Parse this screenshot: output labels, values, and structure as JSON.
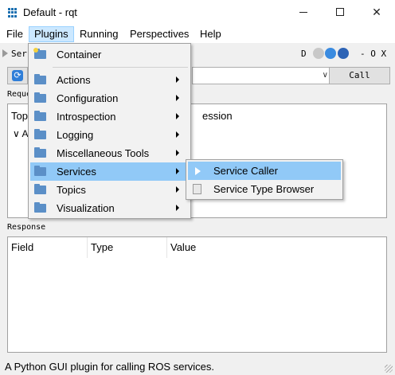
{
  "window": {
    "title": "Default - rqt"
  },
  "menubar": [
    "File",
    "Plugins",
    "Running",
    "Perspectives",
    "Help"
  ],
  "plugin_bar": {
    "title": "Ser",
    "right_label": "D",
    "controls": "- O X"
  },
  "service_row": {
    "combo_value": "",
    "call_label": "Call"
  },
  "request": {
    "label": "Reque",
    "col_left": "Top",
    "col_right": "ession",
    "chevron": "∨ A"
  },
  "response": {
    "label": "Response",
    "columns": [
      "Field",
      "Type",
      "Value"
    ]
  },
  "status": "A Python GUI plugin for calling ROS services.",
  "plugins_menu": {
    "items": [
      {
        "label": "Container",
        "icon": "container-icon",
        "has_submenu": false
      },
      {
        "label": "Actions",
        "icon": "folder-icon",
        "has_submenu": true
      },
      {
        "label": "Configuration",
        "icon": "folder-icon",
        "has_submenu": true
      },
      {
        "label": "Introspection",
        "icon": "folder-icon",
        "has_submenu": true
      },
      {
        "label": "Logging",
        "icon": "folder-icon",
        "has_submenu": true
      },
      {
        "label": "Miscellaneous Tools",
        "icon": "folder-icon",
        "has_submenu": true
      },
      {
        "label": "Services",
        "icon": "folder-icon",
        "has_submenu": true,
        "highlighted": true
      },
      {
        "label": "Topics",
        "icon": "folder-icon",
        "has_submenu": true
      },
      {
        "label": "Visualization",
        "icon": "folder-icon",
        "has_submenu": true
      }
    ]
  },
  "services_submenu": {
    "items": [
      {
        "label": "Service Caller",
        "icon": "play-icon",
        "highlighted": true
      },
      {
        "label": "Service Type Browser",
        "icon": "document-icon"
      }
    ]
  },
  "colors": {
    "highlight": "#91c9f7",
    "menu_active": "#cce8ff",
    "folder": "#5b8fc7"
  }
}
